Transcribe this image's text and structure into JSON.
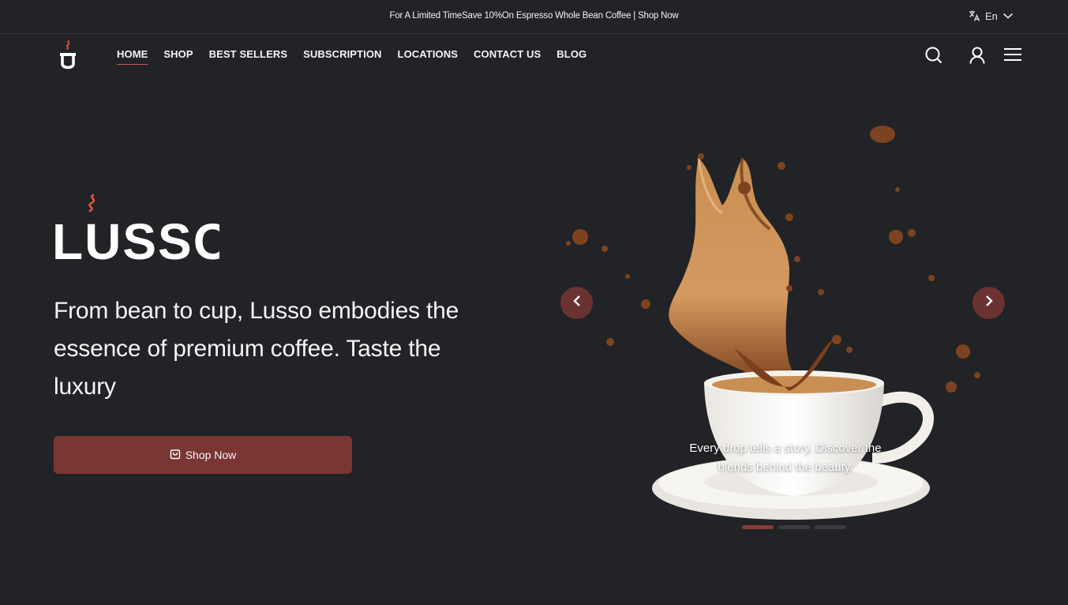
{
  "announcement": {
    "text": "For A Limited TimeSave 10%On Espresso Whole Bean Coffee | Shop Now"
  },
  "language": {
    "current": "En"
  },
  "nav": {
    "items": [
      {
        "label": "HOME",
        "active": true
      },
      {
        "label": "SHOP"
      },
      {
        "label": "BEST SELLERS"
      },
      {
        "label": "SUBSCRIPTION"
      },
      {
        "label": "LOCATIONS"
      },
      {
        "label": "CONTACT US"
      },
      {
        "label": "BLOG"
      }
    ],
    "icons": [
      "search-icon",
      "user-icon",
      "menu-icon"
    ]
  },
  "hero": {
    "brand": "LUSSO",
    "tagline": "From bean to cup, Lusso embodies the essence of premium coffee. Taste the luxury",
    "cta_label": "Shop Now"
  },
  "slider": {
    "caption": "Every drop tells a story. Discover the blends behind the beauty.",
    "slides_count": 3,
    "active_index": 0
  },
  "colors": {
    "background": "#212326",
    "accent": "#7a3633",
    "brand_flame": "#e0573f",
    "arrow": "#6b3232"
  }
}
